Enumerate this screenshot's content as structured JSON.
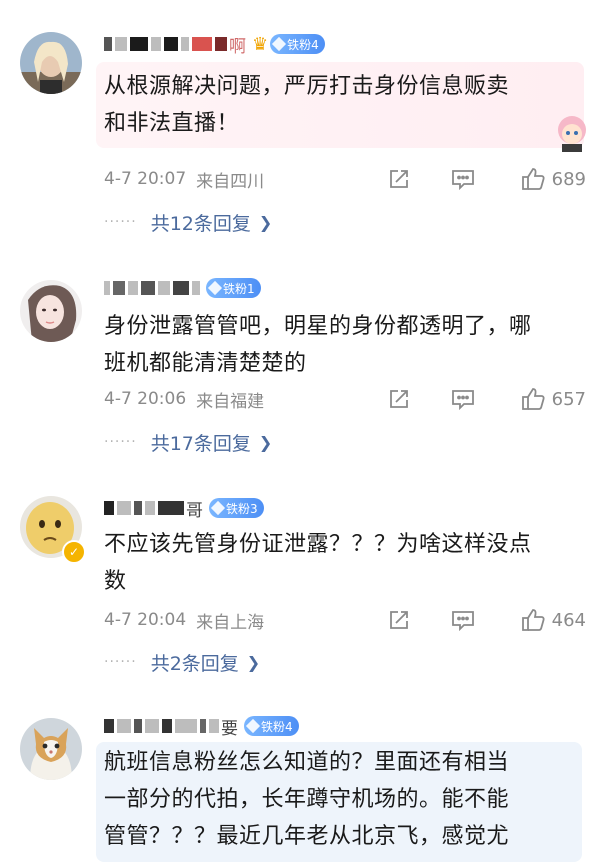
{
  "comments": [
    {
      "name_tail": "啊",
      "badge": "铁粉4",
      "text_lines": [
        "从根源解决问题，严厉打击身份信息贩卖",
        "和非法直播！"
      ],
      "time": "4-7 20:07",
      "location": "来自四川",
      "likes": "689",
      "replies": "共12条回复"
    },
    {
      "name_tail": "",
      "badge": "铁粉1",
      "text_lines": [
        "身份泄露管管吧，明星的身份都透明了，哪",
        "班机都能清清楚楚的"
      ],
      "time": "4-7 20:06",
      "location": "来自福建",
      "likes": "657",
      "replies": "共17条回复"
    },
    {
      "name_tail": "哥",
      "badge": "铁粉3",
      "text_lines": [
        "不应该先管身份证泄露？？？为啥这样没点",
        "数"
      ],
      "time": "4-7 20:04",
      "location": "来自上海",
      "likes": "464",
      "replies": "共2条回复"
    },
    {
      "name_tail": "要",
      "badge": "铁粉4",
      "text_lines": [
        "航班信息粉丝怎么知道的？里面还有相当",
        "一部分的代拍，长年蹲守机场的。能不能",
        "管管？？？最近几年老从北京飞，感觉尤"
      ]
    }
  ],
  "icons": {
    "share": "share-icon",
    "comment": "comment-icon",
    "like": "thumbs-up-icon",
    "reply_more": "chevron-right-icon",
    "dots": "ellipsis-dots"
  },
  "colors": {
    "reply_link": "#4b6a9d",
    "meta_text": "#8a8a8a",
    "badge": "#4d8ff5"
  }
}
